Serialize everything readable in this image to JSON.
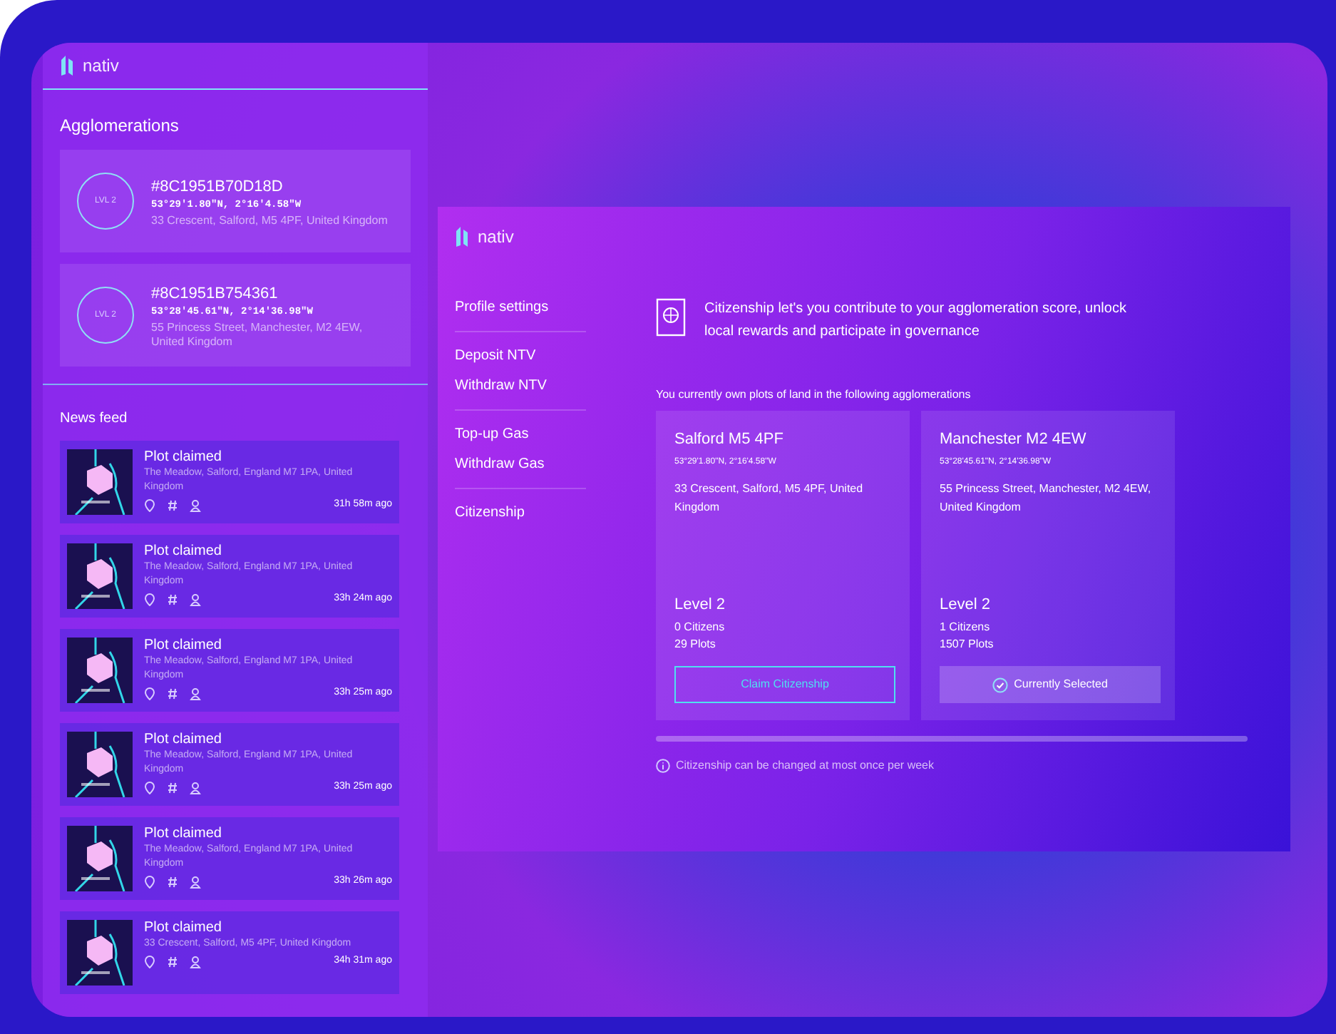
{
  "sidebar": {
    "logo": "nativ",
    "agglomerations_title": "Agglomerations",
    "agglomerations": [
      {
        "level": "LVL 2",
        "id": "#8C1951B70D18D",
        "coords": "53°29'1.80\"N, 2°16'4.58\"W",
        "address": "33 Crescent, Salford, M5 4PF, United Kingdom"
      },
      {
        "level": "LVL 2",
        "id": "#8C1951B754361",
        "coords": "53°28'45.61\"N, 2°14'36.98\"W",
        "address": "55 Princess Street, Manchester, M2 4EW, United Kingdom"
      }
    ],
    "news_title": "News feed",
    "news": [
      {
        "title": "Plot claimed",
        "address": "The Meadow, Salford, England M7 1PA, United Kingdom",
        "time": "31h 58m ago"
      },
      {
        "title": "Plot claimed",
        "address": "The Meadow, Salford, England M7 1PA, United Kingdom",
        "time": "33h 24m ago"
      },
      {
        "title": "Plot claimed",
        "address": "The Meadow, Salford, England M7 1PA, United Kingdom",
        "time": "33h 25m ago"
      },
      {
        "title": "Plot claimed",
        "address": "The Meadow, Salford, England M7 1PA, United Kingdom",
        "time": "33h 25m ago"
      },
      {
        "title": "Plot claimed",
        "address": "The Meadow, Salford, England M7 1PA, United Kingdom",
        "time": "33h 26m ago"
      },
      {
        "title": "Plot claimed",
        "address": "33 Crescent, Salford, M5 4PF, United Kingdom",
        "time": "34h 31m ago"
      }
    ]
  },
  "dialog": {
    "logo": "nativ",
    "menu_groups": [
      [
        "Profile settings"
      ],
      [
        "Deposit NTV",
        "Withdraw NTV"
      ],
      [
        "Top-up Gas",
        "Withdraw Gas"
      ],
      [
        "Citizenship"
      ]
    ],
    "intro": "Citizenship let's you contribute to your agglomeration score, unlock local rewards and participate in governance",
    "plots_heading": "You currently own plots of land in the following agglomerations",
    "cards": [
      {
        "name": "Salford M5 4PF",
        "coords": "53°29'1.80\"N, 2°16'4.58\"W",
        "address": "33 Crescent, Salford, M5 4PF, United Kingdom",
        "level": "Level 2",
        "citizens": "0 Citizens",
        "plots": "29 Plots",
        "action": "Claim Citizenship",
        "selected": false
      },
      {
        "name": "Manchester M2 4EW",
        "coords": "53°28'45.61\"N, 2°14'36.98\"W",
        "address": "55 Princess Street, Manchester, M2 4EW, United Kingdom",
        "level": "Level 2",
        "citizens": "1 Citizens",
        "plots": "1507 Plots",
        "action": "Currently Selected",
        "selected": true
      }
    ],
    "note": "Citizenship can be changed at most once per week"
  }
}
